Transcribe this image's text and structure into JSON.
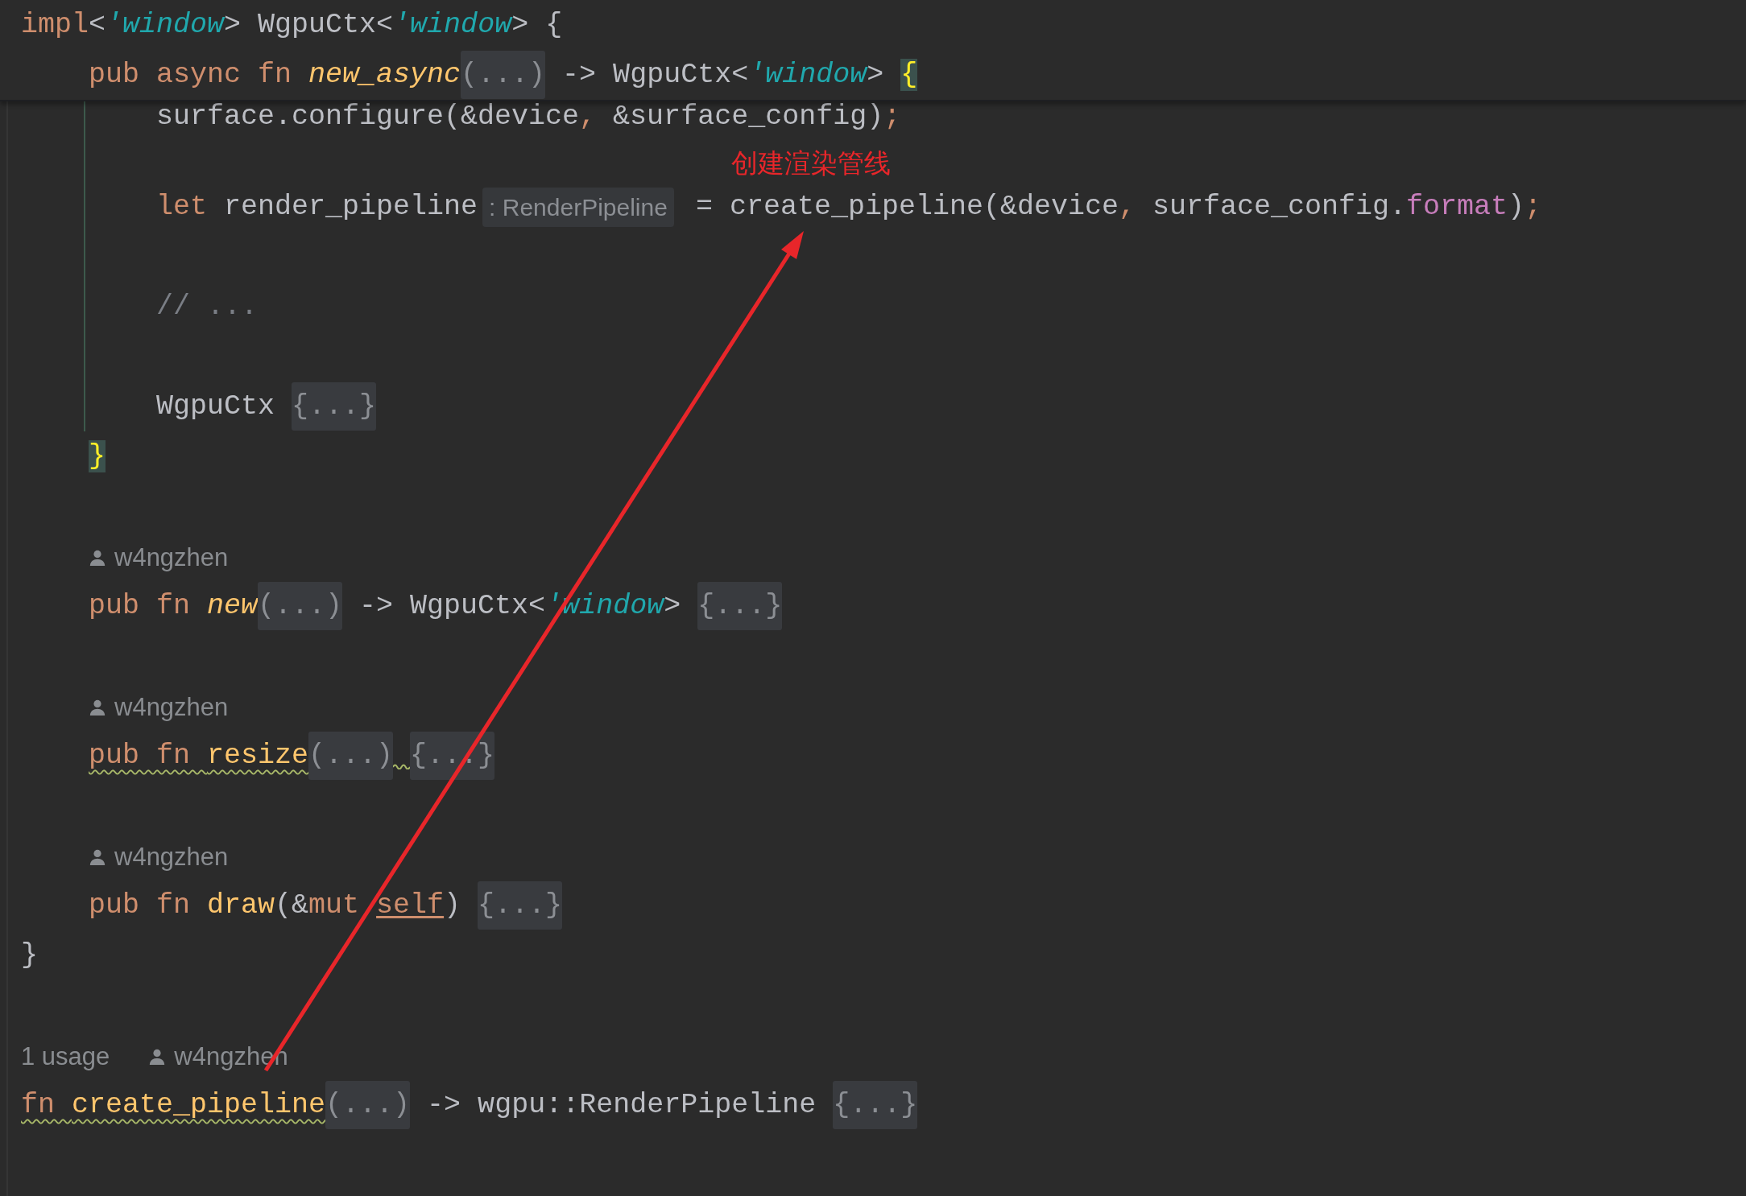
{
  "header_lines": [
    {
      "indented": false,
      "tokens": [
        {
          "kind": "keyword",
          "text": "impl"
        },
        {
          "kind": "text",
          "text": "<"
        },
        {
          "kind": "lifetime",
          "text": "'window"
        },
        {
          "kind": "text",
          "text": "> WgpuCtx<"
        },
        {
          "kind": "lifetime",
          "text": "'window"
        },
        {
          "kind": "text",
          "text": "> {"
        }
      ]
    },
    {
      "indented": true,
      "tokens": [
        {
          "kind": "keyword",
          "text": "pub async fn "
        },
        {
          "kind": "italicfunction",
          "text": "new_async"
        },
        {
          "kind": "fold",
          "text": "(...)"
        },
        {
          "kind": "text",
          "text": " -> WgpuCtx<"
        },
        {
          "kind": "lifetime",
          "text": "'window"
        },
        {
          "kind": "text",
          "text": "> "
        },
        {
          "kind": "matchbrace",
          "text": "{"
        }
      ]
    }
  ],
  "body_lines": [
    {
      "kind": "cut",
      "tokens": [
        {
          "kind": "text",
          "text": "surface.configure(&device"
        },
        {
          "kind": "punct",
          "text": ","
        },
        {
          "kind": "text",
          "text": " &surface_config)"
        },
        {
          "kind": "punct",
          "text": ";"
        }
      ]
    },
    {
      "kind": "blank"
    },
    {
      "kind": "code",
      "tokens": [
        {
          "kind": "keyword",
          "text": "let "
        },
        {
          "kind": "text",
          "text": "render_pipeline"
        },
        {
          "kind": "hint",
          "text": ": RenderPipeline"
        },
        {
          "kind": "text",
          "text": " = create_pipeline(&device"
        },
        {
          "kind": "punct",
          "text": ","
        },
        {
          "kind": "text",
          "text": " surface_config."
        },
        {
          "kind": "field",
          "text": "format"
        },
        {
          "kind": "text",
          "text": ")"
        },
        {
          "kind": "punct",
          "text": ";"
        }
      ]
    },
    {
      "kind": "blank"
    },
    {
      "kind": "code",
      "tokens": [
        {
          "kind": "comment",
          "text": "// ..."
        }
      ]
    },
    {
      "kind": "blank"
    },
    {
      "kind": "code",
      "tokens": [
        {
          "kind": "text",
          "text": "WgpuCtx "
        },
        {
          "kind": "fold",
          "text": "{...}"
        }
      ]
    }
  ],
  "lines": [
    {
      "kind": "code",
      "indented": true,
      "tokens": [
        {
          "kind": "matchbrace",
          "text": "}"
        }
      ]
    },
    {
      "kind": "blank"
    },
    {
      "kind": "authors",
      "indented": true,
      "author": "w4ngzhen"
    },
    {
      "kind": "code",
      "indented": true,
      "tokens": [
        {
          "kind": "keyword",
          "text": "pub fn "
        },
        {
          "kind": "italicfunction",
          "text": "new"
        },
        {
          "kind": "fold",
          "text": "(...)"
        },
        {
          "kind": "text",
          "text": " -> WgpuCtx<"
        },
        {
          "kind": "lifetime",
          "text": "'window"
        },
        {
          "kind": "text",
          "text": "> "
        },
        {
          "kind": "fold",
          "text": "{...}"
        }
      ]
    },
    {
      "kind": "blank"
    },
    {
      "kind": "authors",
      "indented": true,
      "author": "w4ngzhen"
    },
    {
      "kind": "code",
      "indented": true,
      "tokens": [
        {
          "kind": "warning",
          "tokens": [
            {
              "kind": "keyword",
              "text": "pub fn "
            },
            {
              "kind": "function",
              "text": "resize"
            }
          ]
        },
        {
          "kind": "fold",
          "text": "(...)"
        },
        {
          "kind": "squiggle"
        },
        {
          "kind": "fold",
          "text": "{...}"
        }
      ]
    },
    {
      "kind": "blank"
    },
    {
      "kind": "authors",
      "indented": true,
      "author": "w4ngzhen"
    },
    {
      "kind": "code",
      "indented": true,
      "tokens": [
        {
          "kind": "keyword",
          "text": "pub fn "
        },
        {
          "kind": "function",
          "text": "draw"
        },
        {
          "kind": "text",
          "text": "(&"
        },
        {
          "kind": "keyword",
          "text": "mut "
        },
        {
          "kind": "selfword",
          "text": "self"
        },
        {
          "kind": "text",
          "text": ") "
        },
        {
          "kind": "fold",
          "text": "{...}"
        }
      ]
    },
    {
      "kind": "code",
      "indented": false,
      "tokens": [
        {
          "kind": "text",
          "text": "}"
        }
      ]
    },
    {
      "kind": "blank"
    },
    {
      "kind": "authors",
      "indented": false,
      "usage": "1 usage",
      "author": "w4ngzhen"
    },
    {
      "kind": "code",
      "indented": false,
      "tokens": [
        {
          "kind": "warning",
          "tokens": [
            {
              "kind": "keyword",
              "text": "fn "
            },
            {
              "kind": "function",
              "text": "create_pipeline"
            }
          ]
        },
        {
          "kind": "fold",
          "text": "(...)"
        },
        {
          "kind": "text",
          "text": " -> wgpu::RenderPipeline "
        },
        {
          "kind": "fold",
          "text": "{...}"
        }
      ]
    }
  ],
  "annotation": {
    "label": "创建渲染管线"
  }
}
